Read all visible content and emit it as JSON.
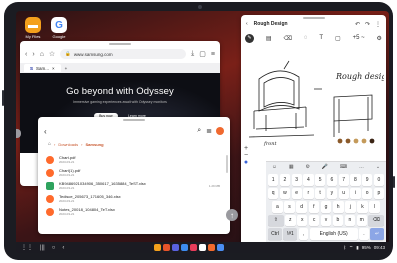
{
  "home": {
    "apps": [
      {
        "label": "My Files",
        "color": "#f4a01c",
        "glyph": "▬"
      },
      {
        "label": "Google",
        "color": "#ffffff",
        "glyph": "G"
      }
    ]
  },
  "browser": {
    "url": "www.samsung.com",
    "tab_label": "Sam...",
    "new_tab": "+",
    "hero_title": "Go beyond with Odyssey",
    "hero_subtitle": "Immersive gaming experiences await with Odyssey monitors",
    "cta_primary": "Buy now",
    "cta_secondary": "Learn more"
  },
  "files": {
    "breadcrumb": [
      "Downloads",
      "Samsung"
    ],
    "items": [
      {
        "name": "Chart.pdf",
        "meta": "2023-03-21",
        "size": "",
        "type": "pdf"
      },
      {
        "name": "Chart(1).pdf",
        "meta": "2023-03-21",
        "size": "",
        "type": "pdf"
      },
      {
        "name": "KB9486921034906_350617_1635884_TeST.xlsx",
        "meta": "2023-03-21",
        "size": "1.29 MB",
        "type": "xl"
      },
      {
        "name": "Tedisce_205673_171605_346.xlsx",
        "meta": "2023-03-21",
        "size": "",
        "type": "pdf"
      },
      {
        "name": "Notes_20018_104804_TeT.xlsx",
        "meta": "2023-03-21",
        "size": "",
        "type": "pdf"
      }
    ]
  },
  "notes": {
    "title": "Rough Design",
    "zoom": "+5 ~"
  },
  "keyboard": {
    "toolbar": [
      "☺",
      "▦",
      "⚙",
      "🎤",
      "⌨",
      "…",
      "⌄"
    ],
    "rows": [
      [
        "1",
        "2",
        "3",
        "4",
        "5",
        "6",
        "7",
        "8",
        "9",
        "0"
      ],
      [
        "q",
        "w",
        "e",
        "r",
        "t",
        "y",
        "u",
        "i",
        "o",
        "p"
      ],
      [
        "a",
        "s",
        "d",
        "f",
        "g",
        "h",
        "j",
        "k",
        "l"
      ],
      [
        "⇧",
        "z",
        "x",
        "c",
        "v",
        "b",
        "n",
        "m",
        "⌫"
      ],
      [
        "Ctrl",
        "!#1",
        ",",
        "English (US)",
        ".",
        "↵"
      ]
    ]
  },
  "status": {
    "battery": "95%",
    "time": "09:43"
  }
}
